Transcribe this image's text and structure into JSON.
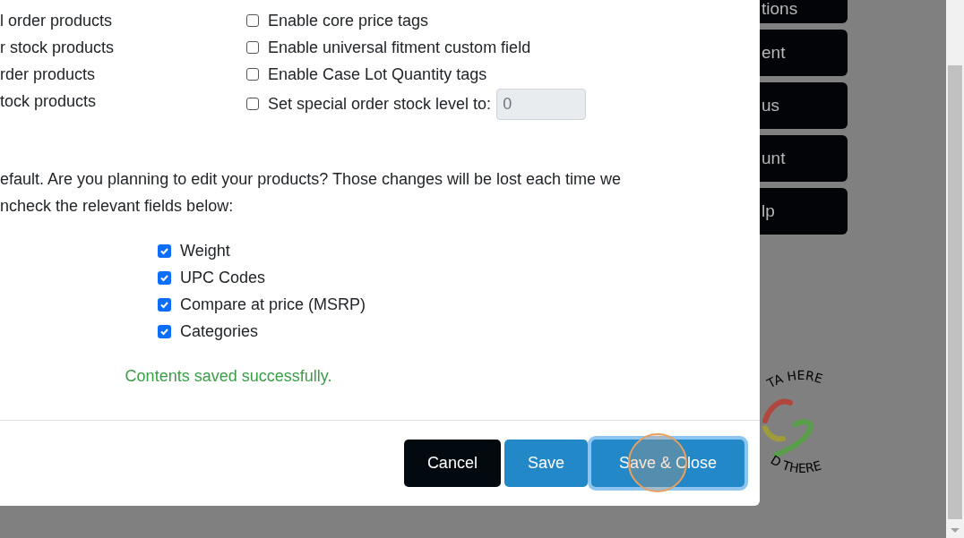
{
  "modal": {
    "left_options": [
      "l order products",
      "r stock products",
      "rder products",
      "tock products"
    ],
    "right_options": [
      {
        "label": "Enable core price tags",
        "checked": false
      },
      {
        "label": "Enable universal fitment custom field",
        "checked": false
      },
      {
        "label": "Enable Case Lot Quantity tags",
        "checked": false
      },
      {
        "label": "Set special order stock level to:",
        "checked": false,
        "value": "0"
      }
    ],
    "notice_lines": [
      "efault. Are you planning to edit your products? Those changes will be lost each time we",
      "ncheck the relevant fields below:"
    ],
    "update_fields": [
      {
        "label": "Weight",
        "checked": true
      },
      {
        "label": "UPC Codes",
        "checked": true
      },
      {
        "label": "Compare at price (MSRP)",
        "checked": true
      },
      {
        "label": "Categories",
        "checked": true
      }
    ],
    "message": "Contents saved successfully.",
    "buttons": [
      {
        "label": "Cancel",
        "kind": "dark",
        "focused": false
      },
      {
        "label": "Save",
        "kind": "primary",
        "focused": false
      },
      {
        "label": "Save & Close",
        "kind": "primary",
        "focused": true
      }
    ]
  },
  "nav_buttons": [
    "tions",
    "ent",
    "us",
    "unt",
    "lp"
  ],
  "logo": {
    "top_text": "TA HERE",
    "bottom_text": "D THERE"
  }
}
